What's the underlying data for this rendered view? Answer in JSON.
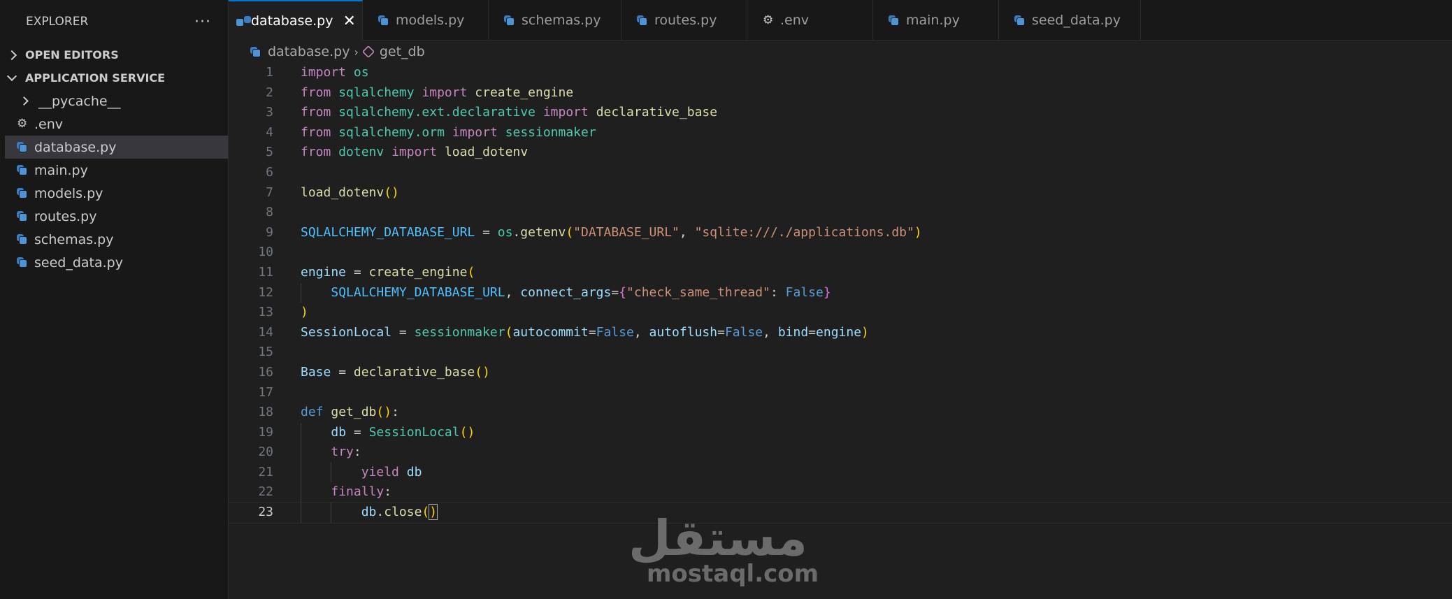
{
  "sidebar": {
    "title": "EXPLORER",
    "more": "···",
    "open_editors": "OPEN EDITORS",
    "project": "APPLICATION SERVICE",
    "items": [
      {
        "label": "__pycache__",
        "icon": "chevron-right-icon"
      },
      {
        "label": ".env",
        "icon": "gear-icon"
      },
      {
        "label": "database.py",
        "icon": "python-icon"
      },
      {
        "label": "main.py",
        "icon": "python-icon"
      },
      {
        "label": "models.py",
        "icon": "python-icon"
      },
      {
        "label": "routes.py",
        "icon": "python-icon"
      },
      {
        "label": "schemas.py",
        "icon": "python-icon"
      },
      {
        "label": "seed_data.py",
        "icon": "python-icon"
      }
    ]
  },
  "tabs": [
    {
      "label": "database.py",
      "icon": "python-icon",
      "active": true
    },
    {
      "label": "models.py",
      "icon": "python-icon"
    },
    {
      "label": "schemas.py",
      "icon": "python-icon"
    },
    {
      "label": "routes.py",
      "icon": "python-icon"
    },
    {
      "label": ".env",
      "icon": "gear-icon"
    },
    {
      "label": "main.py",
      "icon": "python-icon"
    },
    {
      "label": "seed_data.py",
      "icon": "python-icon"
    }
  ],
  "tab_close": "✕",
  "breadcrumb": {
    "file": "database.py",
    "symbol": "get_db"
  },
  "editor": {
    "current_line": 23,
    "lines": [
      [
        [
          "kw",
          "import"
        ],
        [
          "pl",
          " "
        ],
        [
          "mod",
          "os"
        ]
      ],
      [
        [
          "kw",
          "from"
        ],
        [
          "pl",
          " "
        ],
        [
          "mod",
          "sqlalchemy"
        ],
        [
          "pl",
          " "
        ],
        [
          "kw",
          "import"
        ],
        [
          "pl",
          " "
        ],
        [
          "fn",
          "create_engine"
        ]
      ],
      [
        [
          "kw",
          "from"
        ],
        [
          "pl",
          " "
        ],
        [
          "mod",
          "sqlalchemy.ext.declarative"
        ],
        [
          "pl",
          " "
        ],
        [
          "kw",
          "import"
        ],
        [
          "pl",
          " "
        ],
        [
          "fn",
          "declarative_base"
        ]
      ],
      [
        [
          "kw",
          "from"
        ],
        [
          "pl",
          " "
        ],
        [
          "mod",
          "sqlalchemy.orm"
        ],
        [
          "pl",
          " "
        ],
        [
          "kw",
          "import"
        ],
        [
          "pl",
          " "
        ],
        [
          "mod",
          "sessionmaker"
        ]
      ],
      [
        [
          "kw",
          "from"
        ],
        [
          "pl",
          " "
        ],
        [
          "mod",
          "dotenv"
        ],
        [
          "pl",
          " "
        ],
        [
          "kw",
          "import"
        ],
        [
          "pl",
          " "
        ],
        [
          "fn",
          "load_dotenv"
        ]
      ],
      [],
      [
        [
          "fn",
          "load_dotenv"
        ],
        [
          "br1",
          "()"
        ]
      ],
      [],
      [
        [
          "cst",
          "SQLALCHEMY_DATABASE_URL"
        ],
        [
          "pl",
          " = "
        ],
        [
          "mod",
          "os"
        ],
        [
          "pl",
          "."
        ],
        [
          "fn",
          "getenv"
        ],
        [
          "br1",
          "("
        ],
        [
          "str",
          "\"DATABASE_URL\""
        ],
        [
          "pl",
          ", "
        ],
        [
          "str",
          "\"sqlite:///./applications.db\""
        ],
        [
          "br1",
          ")"
        ]
      ],
      [],
      [
        [
          "var",
          "engine"
        ],
        [
          "pl",
          " = "
        ],
        [
          "fn",
          "create_engine"
        ],
        [
          "br1",
          "("
        ]
      ],
      [
        [
          "pl",
          "    "
        ],
        [
          "cst",
          "SQLALCHEMY_DATABASE_URL"
        ],
        [
          "pl",
          ", "
        ],
        [
          "var",
          "connect_args"
        ],
        [
          "pl",
          "="
        ],
        [
          "br2",
          "{"
        ],
        [
          "str",
          "\"check_same_thread\""
        ],
        [
          "pl",
          ": "
        ],
        [
          "kw2",
          "False"
        ],
        [
          "br2",
          "}"
        ]
      ],
      [
        [
          "br1",
          ")"
        ]
      ],
      [
        [
          "var",
          "SessionLocal"
        ],
        [
          "pl",
          " = "
        ],
        [
          "mod",
          "sessionmaker"
        ],
        [
          "br1",
          "("
        ],
        [
          "var",
          "autocommit"
        ],
        [
          "pl",
          "="
        ],
        [
          "kw2",
          "False"
        ],
        [
          "pl",
          ", "
        ],
        [
          "var",
          "autoflush"
        ],
        [
          "pl",
          "="
        ],
        [
          "kw2",
          "False"
        ],
        [
          "pl",
          ", "
        ],
        [
          "var",
          "bind"
        ],
        [
          "pl",
          "="
        ],
        [
          "var",
          "engine"
        ],
        [
          "br1",
          ")"
        ]
      ],
      [],
      [
        [
          "var",
          "Base"
        ],
        [
          "pl",
          " = "
        ],
        [
          "fn",
          "declarative_base"
        ],
        [
          "br1",
          "()"
        ]
      ],
      [],
      [
        [
          "kw2",
          "def"
        ],
        [
          "pl",
          " "
        ],
        [
          "fn",
          "get_db"
        ],
        [
          "br1",
          "()"
        ],
        [
          "pl",
          ":"
        ]
      ],
      [
        [
          "pl",
          "    "
        ],
        [
          "var",
          "db"
        ],
        [
          "pl",
          " = "
        ],
        [
          "mod",
          "SessionLocal"
        ],
        [
          "br1",
          "()"
        ]
      ],
      [
        [
          "pl",
          "    "
        ],
        [
          "kw",
          "try"
        ],
        [
          "pl",
          ":"
        ]
      ],
      [
        [
          "pl",
          "        "
        ],
        [
          "kw",
          "yield"
        ],
        [
          "pl",
          " "
        ],
        [
          "var",
          "db"
        ]
      ],
      [
        [
          "pl",
          "    "
        ],
        [
          "kw",
          "finally"
        ],
        [
          "pl",
          ":"
        ]
      ],
      [
        [
          "pl",
          "        "
        ],
        [
          "var",
          "db"
        ],
        [
          "pl",
          "."
        ],
        [
          "fn",
          "close"
        ],
        [
          "br1",
          "("
        ],
        [
          "cur",
          ")"
        ]
      ]
    ]
  },
  "watermark": {
    "arabic": "مستقل",
    "latin": "mostaql.com"
  }
}
